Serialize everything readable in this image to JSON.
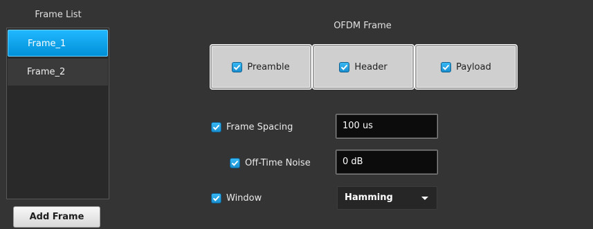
{
  "frame_list": {
    "title": "Frame List",
    "items": [
      {
        "label": "Frame_1",
        "selected": true
      },
      {
        "label": "Frame_2",
        "selected": false
      }
    ],
    "add_button_label": "Add Frame"
  },
  "ofdm": {
    "title": "OFDM Frame",
    "segments": [
      {
        "label": "Preamble",
        "checked": true
      },
      {
        "label": "Header",
        "checked": true
      },
      {
        "label": "Payload",
        "checked": true
      }
    ]
  },
  "options": {
    "frame_spacing": {
      "label": "Frame Spacing",
      "checked": true,
      "value": "100 us"
    },
    "off_time_noise": {
      "label": "Off-Time Noise",
      "checked": true,
      "value": "0 dB"
    },
    "window": {
      "label": "Window",
      "checked": true,
      "selected": "Hamming"
    }
  },
  "colors": {
    "accent": "#0aa3f0",
    "background": "#343434"
  }
}
